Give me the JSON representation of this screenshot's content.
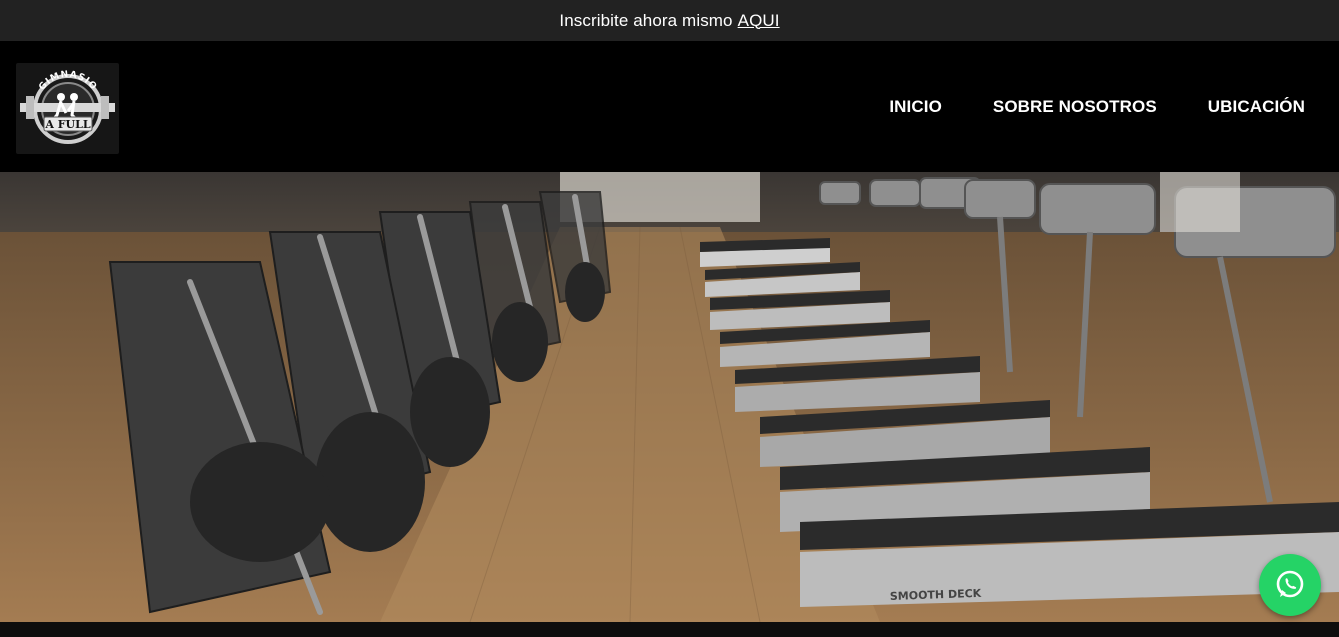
{
  "announcement": {
    "text": "Inscribite ahora mismo",
    "link_label": "AQUI"
  },
  "header": {
    "logo": {
      "arc_text": "GIMNASIO",
      "badge_text": "A FULL"
    },
    "nav": [
      {
        "label": "INICIO"
      },
      {
        "label": "SOBRE NOSOTROS"
      },
      {
        "label": "UBICACIÓN"
      }
    ]
  },
  "hero": {
    "treadmill_brand": "SMOOTH DECK"
  },
  "floating": {
    "icon": "whatsapp-icon",
    "color": "#25d366"
  },
  "colors": {
    "announcement_bg": "#222222",
    "header_bg": "#000000",
    "text": "#ffffff"
  }
}
